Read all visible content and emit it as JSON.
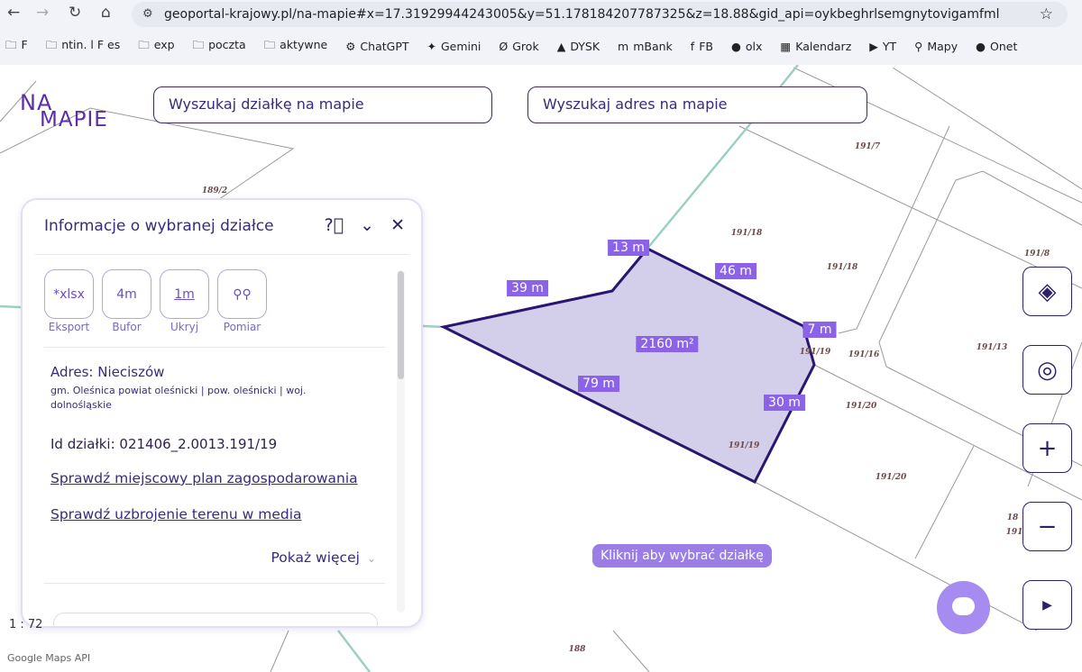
{
  "browser": {
    "url": "geoportal-krajowy.pl/na-mapie#x=17.31929944243005&y=51.178184207787325&z=18.88&gid_api=oykbeghrlsemgnytovigamfml",
    "bookmarks": [
      {
        "icon": "folder-icon",
        "label": "F"
      },
      {
        "icon": "folder-icon",
        "label": "ntin. l F es"
      },
      {
        "icon": "folder-icon",
        "label": "exp"
      },
      {
        "icon": "folder-icon",
        "label": "poczta"
      },
      {
        "icon": "folder-icon",
        "label": "aktywne"
      },
      {
        "icon": "chatgpt-icon",
        "label": "ChatGPT"
      },
      {
        "icon": "gemini-icon",
        "label": "Gemini"
      },
      {
        "icon": "grok-icon",
        "label": "Grok"
      },
      {
        "icon": "drive-icon",
        "label": "DYSK"
      },
      {
        "icon": "mbank-icon",
        "label": "mBank"
      },
      {
        "icon": "facebook-icon",
        "label": "FB"
      },
      {
        "icon": "olx-icon",
        "label": "olx"
      },
      {
        "icon": "calendar-icon",
        "label": "Kalendarz"
      },
      {
        "icon": "youtube-icon",
        "label": "YT"
      },
      {
        "icon": "maps-icon",
        "label": "Mapy"
      },
      {
        "icon": "onet-icon",
        "label": "Onet"
      }
    ]
  },
  "header": {
    "logo_top": "NA",
    "logo_bottom": "MAPIE",
    "search_parcel": "Wyszukaj działkę na mapie",
    "search_address": "Wyszukaj adres na mapie"
  },
  "panel": {
    "title": "Informacje o wybranej działce",
    "tools": [
      {
        "icon": "xlsx",
        "label": "Eksport"
      },
      {
        "icon": "4m",
        "label": "Bufor"
      },
      {
        "icon": "1m",
        "label": "Ukryj"
      },
      {
        "icon": "pins",
        "label": "Pomiar"
      }
    ],
    "address": "Adres: Nieciszów",
    "address_detail": "gm. Oleśnica powiat oleśnicki | pow. oleśnicki | woj. dolnośląskie",
    "parcel_id": "Id działki: 021406_2.0013.191/19",
    "link_plan": "Sprawdź miejscowy plan zagospodarowania",
    "link_media": "Sprawdź uzbrojenie terenu w media",
    "show_more": "Pokaż więcej"
  },
  "map": {
    "area": "2160 m²",
    "edges": [
      "39 m",
      "13 m",
      "46 m",
      "7 m",
      "30 m",
      "79 m"
    ],
    "parcels": [
      "189/2",
      "191/7",
      "191/18",
      "191/18",
      "191/8",
      "191/19",
      "191/16",
      "191/13",
      "191/20",
      "191/19",
      "191/20",
      "18",
      "191",
      "188"
    ],
    "hint": "Kliknij aby wybrać działkę",
    "scale": "1 : 72",
    "attribution": "Google Maps API"
  },
  "colors": {
    "accent": "#8a63e8",
    "dark": "#2e1f6b"
  }
}
